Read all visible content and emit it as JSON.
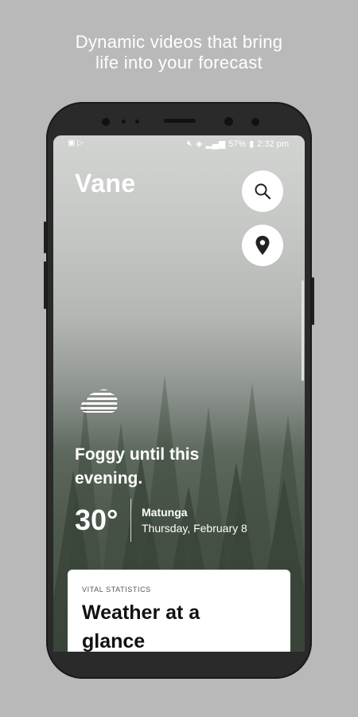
{
  "promo": {
    "line1": "Dynamic videos that bring",
    "line2": "life into your forecast"
  },
  "status_bar": {
    "battery": "57%",
    "time": "2:32 pm"
  },
  "app": {
    "title": "Vane"
  },
  "buttons": {
    "search_icon": "search-icon",
    "location_icon": "location-pin-icon"
  },
  "weather": {
    "condition": "Foggy until this evening.",
    "temperature": "30°",
    "location": "Matunga",
    "date": "Thursday, February 8",
    "icon": "fog-icon"
  },
  "card": {
    "label": "VITAL STATISTICS",
    "title": "Weather at a glance"
  }
}
